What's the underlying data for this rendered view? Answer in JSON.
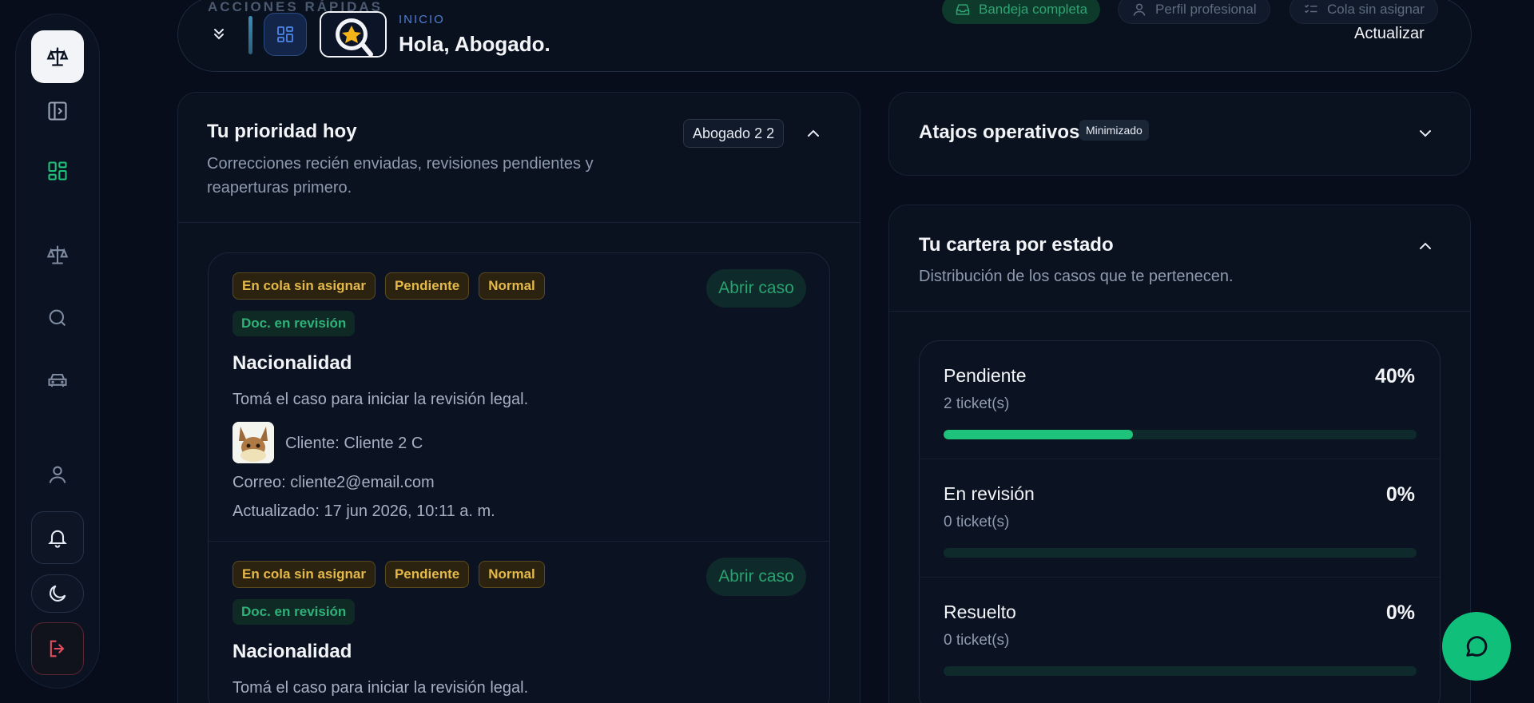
{
  "header": {
    "quick_actions_label": "ACCIONES RÁPIDAS",
    "quick_actions": [
      {
        "label": "Bandeja completa",
        "icon": "inbox-icon"
      },
      {
        "label": "Perfil profesional",
        "icon": "user-icon"
      },
      {
        "label": "Cola sin asignar",
        "icon": "list-check-icon"
      }
    ],
    "section_label": "INICIO",
    "greeting": "Hola, Abogado.",
    "refresh_label": "Actualizar"
  },
  "sidebar": {
    "items": [
      {
        "name": "logo",
        "icon": "scale-icon"
      },
      {
        "name": "toggle-sidebar",
        "icon": "panel-toggle-icon"
      },
      {
        "name": "dashboard",
        "icon": "dashboard-grid-icon"
      },
      {
        "name": "cases",
        "icon": "scale-icon"
      },
      {
        "name": "search",
        "icon": "search-icon"
      },
      {
        "name": "vehicles",
        "icon": "car-icon"
      },
      {
        "name": "profile",
        "icon": "user-icon"
      },
      {
        "name": "notifications",
        "icon": "bell-icon"
      },
      {
        "name": "theme",
        "icon": "moon-icon"
      },
      {
        "name": "logout",
        "icon": "logout-icon"
      }
    ]
  },
  "priority": {
    "title": "Tu prioridad hoy",
    "subtitle_1": "Correcciones recién enviadas, revisiones pendientes y",
    "subtitle_2": "reaperturas primero.",
    "assignee_badge": "Abogado 2 2",
    "cases": [
      {
        "chips": [
          "En cola sin asignar",
          "Pendiente",
          "Normal"
        ],
        "doc_chip": "Doc. en revisión",
        "title": "Nacionalidad",
        "description": "Tomá el caso para iniciar la revisión legal.",
        "client": "Cliente: Cliente 2 C",
        "email": "Correo: cliente2@email.com",
        "updated": "Actualizado: 17 jun 2026, 10:11 a. m.",
        "open_label": "Abrir caso"
      },
      {
        "chips": [
          "En cola sin asignar",
          "Pendiente",
          "Normal"
        ],
        "doc_chip": "Doc. en revisión",
        "title": "Nacionalidad",
        "description": "Tomá el caso para iniciar la revisión legal.",
        "open_label": "Abrir caso"
      }
    ]
  },
  "shortcuts": {
    "title": "Atajos operativos",
    "badge": "Minimizado"
  },
  "portfolio": {
    "title": "Tu cartera por estado",
    "subtitle": "Distribución de los casos que te pertenecen.",
    "statuses": [
      {
        "name": "Pendiente",
        "count": "2 ticket(s)",
        "percent_label": "40%",
        "percent": 40
      },
      {
        "name": "En revisión",
        "count": "0 ticket(s)",
        "percent_label": "0%",
        "percent": 0
      },
      {
        "name": "Resuelto",
        "count": "0 ticket(s)",
        "percent_label": "0%",
        "percent": 0
      }
    ]
  },
  "colors": {
    "accent_green": "#1fc27a",
    "chip_yellow": "#e4b94a",
    "background": "#070d1a"
  }
}
